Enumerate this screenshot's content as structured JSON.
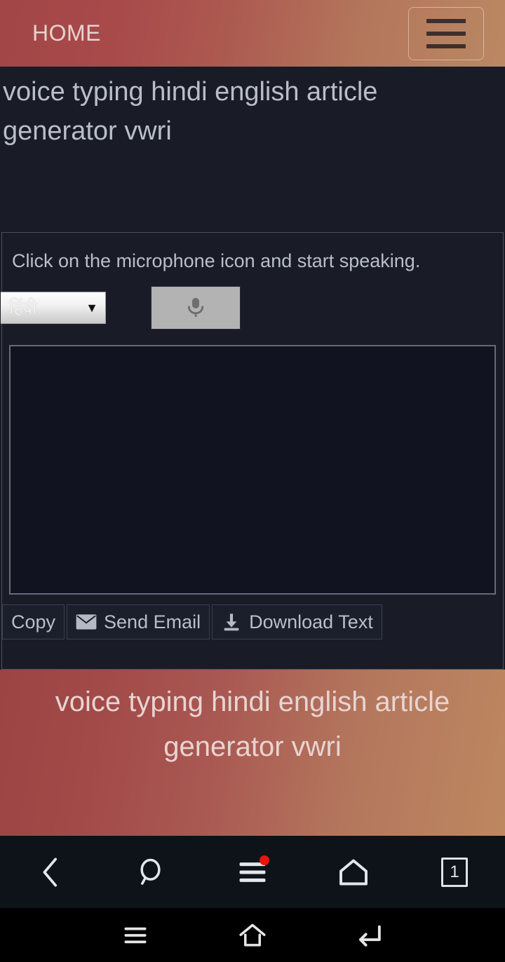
{
  "header": {
    "brand": "HOME",
    "menu_toggle_name": "hamburger-menu-icon",
    "gradient_from": "#a24647",
    "gradient_to": "#ba8862"
  },
  "page": {
    "title": "voice typing hindi english article generator vwri"
  },
  "widget": {
    "hint": "Click on the microphone icon and start speaking.",
    "language_select": {
      "selected": "हिंदी",
      "caret": "▼"
    },
    "mic_button_label": "",
    "textarea_value": "",
    "textarea_placeholder": "",
    "buttons": [
      {
        "label": "Copy",
        "icon": ""
      },
      {
        "label": "Send Email",
        "icon": "envelope-icon"
      },
      {
        "label": "Download Text",
        "icon": "download-icon"
      }
    ]
  },
  "footer": {
    "title": "voice typing hindi english article generator vwri",
    "gradient_from": "#9c4444",
    "gradient_to": "#bd8860"
  },
  "browser_bar": {
    "items": [
      {
        "name": "back-icon",
        "label": ""
      },
      {
        "name": "search-icon",
        "label": ""
      },
      {
        "name": "menu-icon",
        "label": "",
        "badge": true
      },
      {
        "name": "home-icon",
        "label": ""
      },
      {
        "name": "tab-count",
        "label": "1"
      }
    ],
    "badge_color": "#e8140f"
  },
  "android_nav": {
    "items": [
      {
        "name": "recents-icon"
      },
      {
        "name": "home-icon"
      },
      {
        "name": "back-icon"
      }
    ]
  }
}
